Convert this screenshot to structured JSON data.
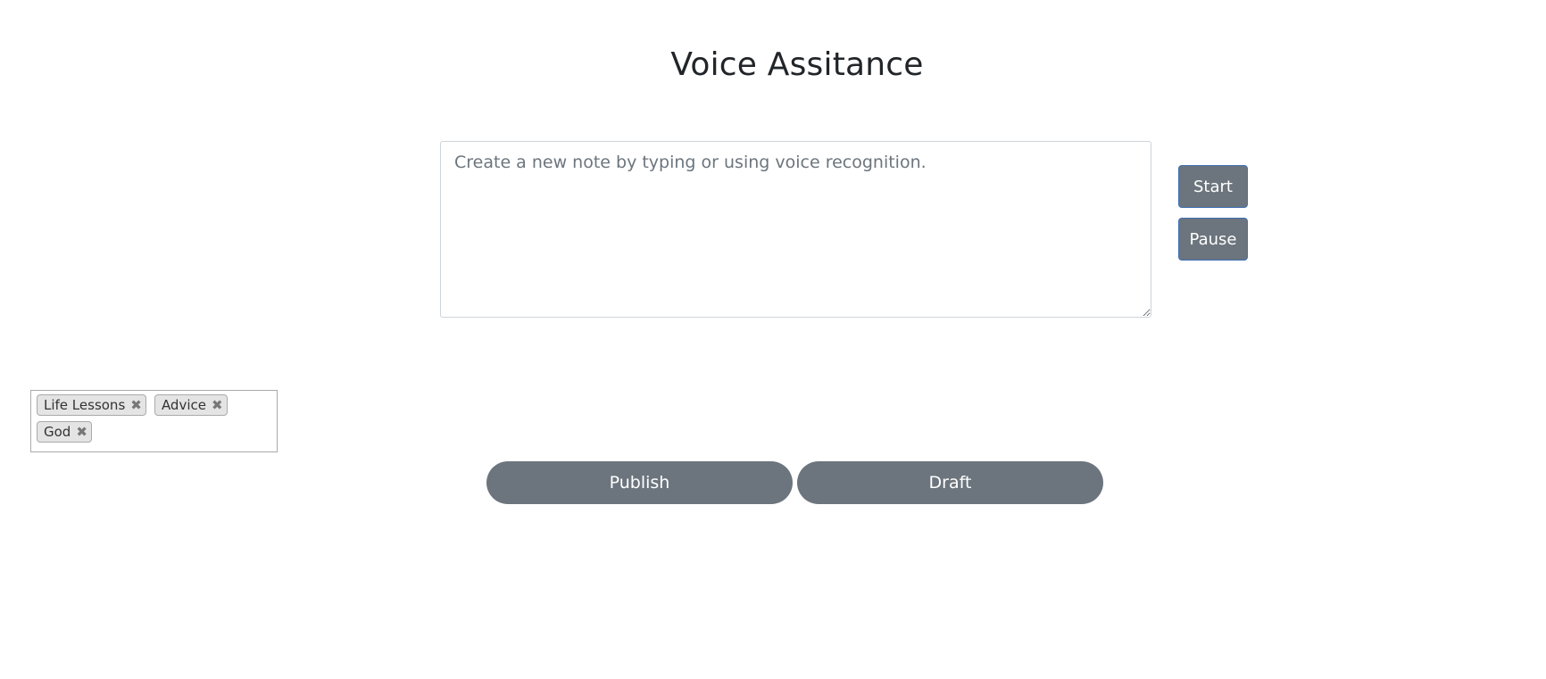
{
  "page": {
    "title": "Voice Assitance"
  },
  "note": {
    "placeholder": "Create a new note by typing or using voice recognition.",
    "value": ""
  },
  "voice_controls": {
    "start_label": "Start",
    "pause_label": "Pause"
  },
  "tags": {
    "items": [
      {
        "label": "Life Lessons",
        "remove_icon": "✖"
      },
      {
        "label": "Advice",
        "remove_icon": "✖"
      },
      {
        "label": "God",
        "remove_icon": "✖"
      }
    ]
  },
  "actions": {
    "publish_label": "Publish",
    "draft_label": "Draft"
  },
  "colors": {
    "button_bg": "#6c757d",
    "button_focus_border": "#3f6fb6",
    "tag_bg": "#e4e4e4"
  }
}
